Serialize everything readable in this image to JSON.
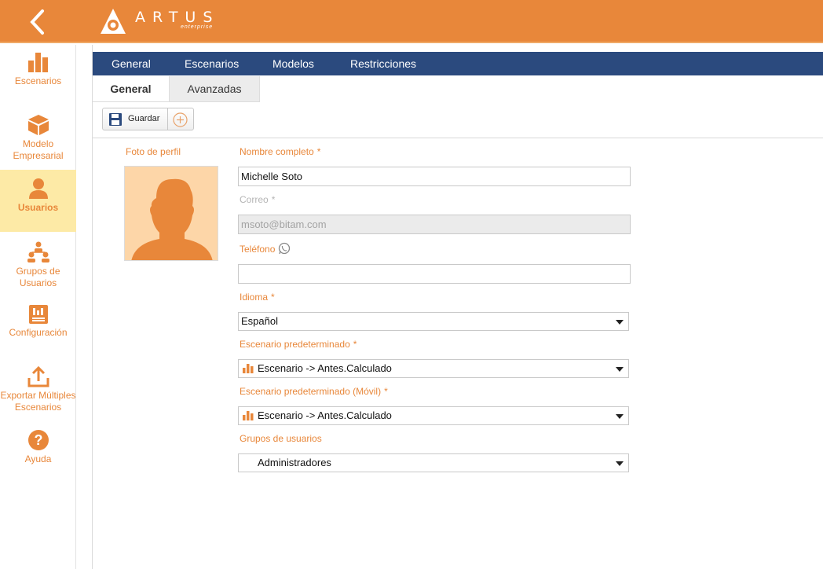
{
  "app": {
    "brand_name": "ARTUS",
    "brand_sub": "enterprise",
    "accent_color": "#e8873a",
    "nav_color": "#2b4a7e"
  },
  "sidebar": {
    "items": [
      {
        "label": "Escenarios",
        "icon": "bar-chart-icon"
      },
      {
        "label": "Modelo Empresarial",
        "icon": "cube-icon"
      },
      {
        "label": "Usuarios",
        "icon": "user-icon",
        "active": true
      },
      {
        "label": "Grupos de Usuarios",
        "icon": "user-group-icon"
      },
      {
        "label": "Configuración",
        "icon": "settings-panel-icon"
      },
      {
        "label": "Exportar Múltiples Escenarios",
        "icon": "export-icon"
      },
      {
        "label": "Ayuda",
        "icon": "help-icon"
      }
    ]
  },
  "tabs": [
    "General",
    "Escenarios",
    "Modelos",
    "Restricciones"
  ],
  "subtabs": [
    "General",
    "Avanzadas"
  ],
  "toolbar": {
    "save_label": "Guardar"
  },
  "form": {
    "photo_label": "Foto de perfil",
    "fullname_label": "Nombre completo",
    "fullname_value": "Michelle Soto",
    "email_label": "Correo",
    "email_value": "msoto@bitam.com",
    "phone_label": "Teléfono",
    "phone_value": "",
    "language_label": "Idioma",
    "language_value": "Español",
    "scenario_label": "Escenario predeterminado",
    "scenario_value": "Escenario -> Antes.Calculado",
    "scenario_mobile_label": "Escenario predeterminado (Móvil)",
    "scenario_mobile_value": "Escenario -> Antes.Calculado",
    "groups_label": "Grupos de usuarios",
    "groups_value": "Administradores",
    "required_mark": "*"
  }
}
